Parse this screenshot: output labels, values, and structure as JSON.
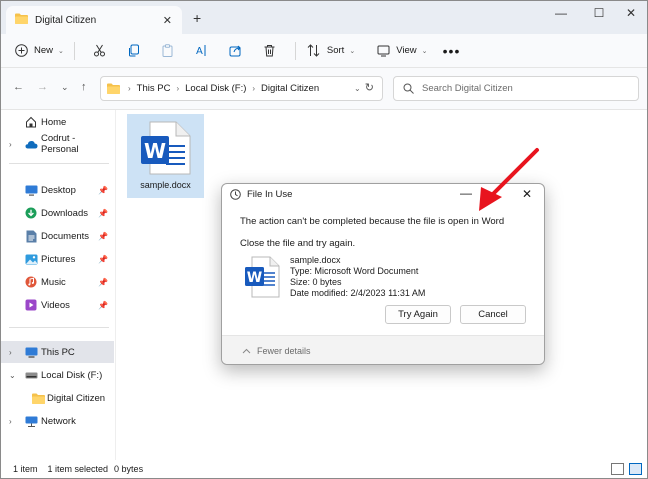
{
  "window": {
    "tab_title": "Digital Citizen",
    "tab_close_icon": "close-icon",
    "new_tab_icon": "plus-icon"
  },
  "command_bar": {
    "new_label": "New",
    "sort_label": "Sort",
    "view_label": "View"
  },
  "address": {
    "crumbs": [
      "This PC",
      "Local Disk (F:)",
      "Digital Citizen"
    ],
    "search_placeholder": "Search Digital Citizen"
  },
  "sidebar": {
    "items": [
      {
        "label": "Home"
      },
      {
        "label": "Codrut - Personal"
      },
      {
        "label": "Desktop"
      },
      {
        "label": "Downloads"
      },
      {
        "label": "Documents"
      },
      {
        "label": "Pictures"
      },
      {
        "label": "Music"
      },
      {
        "label": "Videos"
      },
      {
        "label": "This PC"
      },
      {
        "label": "Local Disk (F:)"
      },
      {
        "label": "Digital Citizen"
      },
      {
        "label": "Network"
      }
    ]
  },
  "content": {
    "file_name": "sample.docx"
  },
  "status": {
    "item_count": "1 item",
    "selected": "1 item selected",
    "size": "0 bytes"
  },
  "dialog": {
    "title": "File In Use",
    "message": "The action can't be completed because the file is open in Word",
    "instruction": "Close the file and try again.",
    "file_name": "sample.docx",
    "file_type": "Type: Microsoft Word Document",
    "file_size": "Size: 0 bytes",
    "date_modified": "Date modified: 2/4/2023 11:31 AM",
    "try_again_label": "Try Again",
    "cancel_label": "Cancel",
    "fewer_details_label": "Fewer details"
  },
  "colors": {
    "accent": "#0067c0",
    "word_blue": "#185abd",
    "folder_yellow": "#f5c14b",
    "selection": "#cde2f5",
    "arrow_red": "#e8141e"
  }
}
